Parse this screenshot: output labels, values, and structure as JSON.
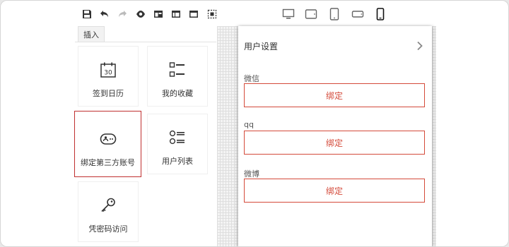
{
  "toolbar": {
    "buttons": [
      {
        "name": "save-icon"
      },
      {
        "name": "undo-icon"
      },
      {
        "name": "redo-icon"
      },
      {
        "name": "preview-eye-icon"
      },
      {
        "name": "layout-left-icon"
      },
      {
        "name": "layout-top-icon"
      },
      {
        "name": "layout-header-icon"
      },
      {
        "name": "select-area-icon"
      }
    ],
    "devices": [
      {
        "name": "desktop-icon"
      },
      {
        "name": "tablet-landscape-icon"
      },
      {
        "name": "tablet-portrait-icon"
      },
      {
        "name": "phone-landscape-icon"
      },
      {
        "name": "phone-portrait-icon"
      }
    ]
  },
  "sidebar": {
    "tab_label": "插入",
    "components": [
      {
        "label": "签到日历",
        "icon": "calendar-icon",
        "calendar_day": "30"
      },
      {
        "label": "我的收藏",
        "icon": "favorites-list-icon"
      },
      {
        "label": "绑定第三方账号",
        "icon": "bind-account-icon",
        "selected": true
      },
      {
        "label": "用户列表",
        "icon": "user-list-icon"
      },
      {
        "label": "凭密码访问",
        "icon": "key-icon"
      }
    ]
  },
  "preview": {
    "title": "用户设置",
    "bindings": [
      {
        "label": "微信",
        "button": "绑定"
      },
      {
        "label": "qq",
        "button": "绑定"
      },
      {
        "label": "微博",
        "button": "绑定"
      }
    ]
  },
  "colors": {
    "accent": "#d44a3a",
    "selected_border": "#c03030",
    "icon": "#333333"
  }
}
